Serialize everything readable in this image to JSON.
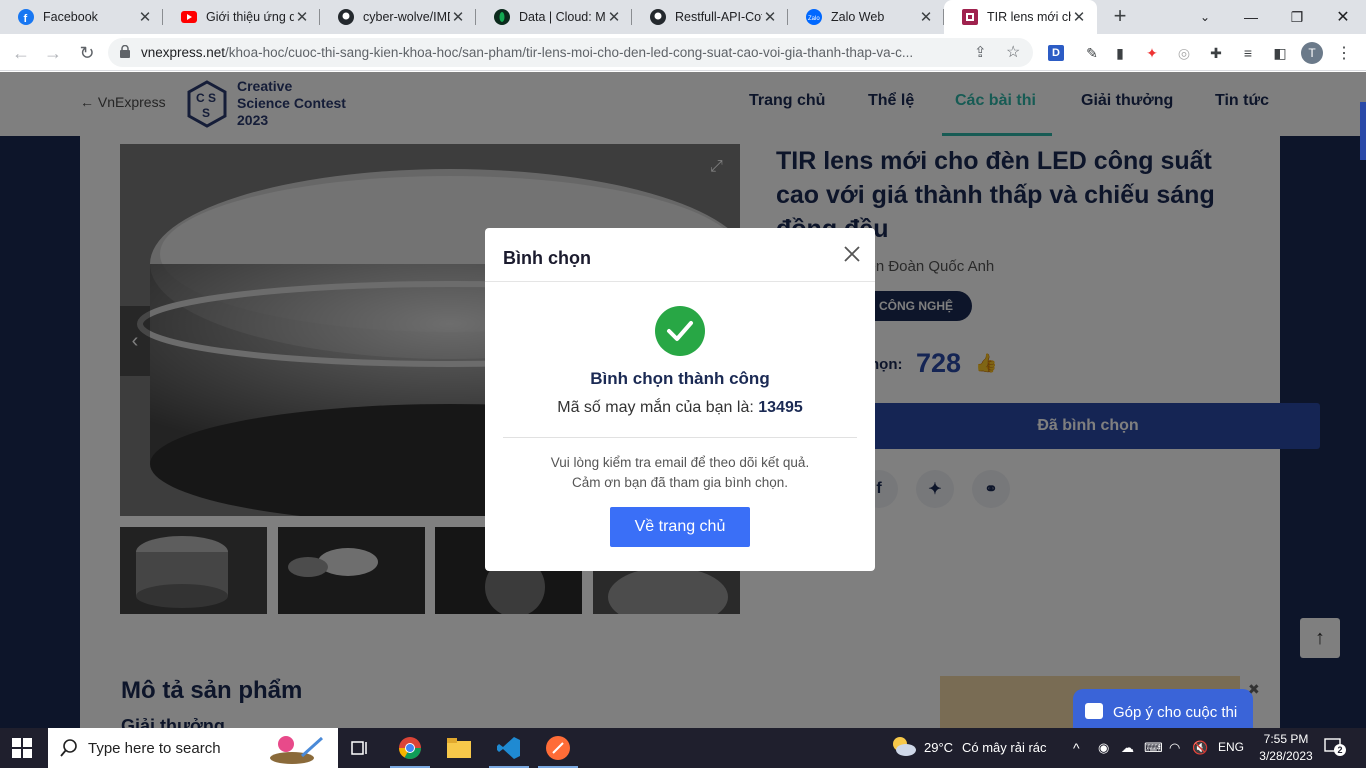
{
  "browser": {
    "tabs": [
      {
        "title": "Facebook",
        "icon": "facebook-icon",
        "color": "#1877f2"
      },
      {
        "title": "Giới thiệu ứng dụ",
        "icon": "youtube-icon",
        "color": "#ff0000"
      },
      {
        "title": "cyber-wolve/IMD",
        "icon": "github-icon",
        "color": "#24292e"
      },
      {
        "title": "Data | Cloud: Mo",
        "icon": "mongodb-icon",
        "color": "#13aa52"
      },
      {
        "title": "Restfull-API-Coffe",
        "icon": "github-icon",
        "color": "#24292e"
      },
      {
        "title": "Zalo Web",
        "icon": "zalo-icon",
        "color": "#0068ff"
      },
      {
        "title": "TIR lens mới cho",
        "icon": "vnexpress-icon",
        "color": "#9f224e",
        "active": true
      }
    ],
    "url_domain": "vnexpress.net",
    "url_path": "/khoa-hoc/cuoc-thi-sang-kien-khoa-hoc/san-pham/tir-lens-moi-cho-den-led-cong-suat-cao-voi-gia-thanh-thap-va-c...",
    "profile_initial": "T",
    "extension_d": "D"
  },
  "site": {
    "back": "← VnExpress",
    "logo_text": [
      "Creative",
      "Science Contest",
      "2023"
    ],
    "nav": [
      "Trang chủ",
      "Thể lệ",
      "Các bài thi",
      "Giải thưởng",
      "Tin tức"
    ],
    "nav_active": 2
  },
  "product": {
    "title": "TIR lens mới cho đèn LED công suất cao với giá thành thấp và chiếu sáng đồng đều",
    "author": "yễn Đoàn Quốc Anh",
    "category": "CÔNG NGHỆ",
    "vote_label": "họn:",
    "vote_count": "728",
    "voted_button": "Đã bình chọn",
    "share": [
      "f",
      "t",
      "link"
    ],
    "section_title": "Mô tả sản phẩm",
    "section_sub": "Giải thưởng"
  },
  "feedback_label": "Góp ý cho cuộc thi",
  "modal": {
    "title": "Bình chọn",
    "success": "Bình chọn thành công",
    "code_label": "Mã số may mắn của bạn là:",
    "code": "13495",
    "note_line1": "Vui lòng kiểm tra email để theo dõi kết quả.",
    "note_line2": "Cảm ơn bạn đã tham gia bình chọn.",
    "home_button": "Về trang chủ"
  },
  "taskbar": {
    "search_placeholder": "Type here to search",
    "weather_temp": "29°C",
    "weather_text": "Có mây rải rác",
    "lang": "ENG",
    "time": "7:55 PM",
    "date": "3/28/2023",
    "notifications": "2"
  }
}
